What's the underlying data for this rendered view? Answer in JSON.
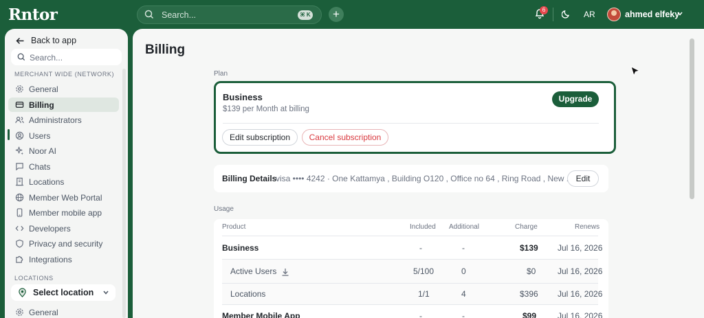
{
  "topbar": {
    "logo": "Rntor",
    "search_placeholder": "Search...",
    "search_shortcut": "⌘ K",
    "notification_count": "6",
    "language": "AR",
    "user_name": "ahmed elfeky"
  },
  "sidebar": {
    "back_label": "Back to app",
    "search_placeholder": "Search...",
    "section_network": "MERCHANT WIDE (NETWORK)",
    "items": [
      {
        "label": "General",
        "icon": "gear-icon"
      },
      {
        "label": "Billing",
        "icon": "card-icon",
        "active": true
      },
      {
        "label": "Administrators",
        "icon": "people-icon"
      },
      {
        "label": "Users",
        "icon": "user-circle-icon"
      },
      {
        "label": "Noor AI",
        "icon": "sparkle-icon"
      },
      {
        "label": "Chats",
        "icon": "chat-icon"
      },
      {
        "label": "Locations",
        "icon": "building-icon"
      },
      {
        "label": "Member Web Portal",
        "icon": "globe-icon"
      },
      {
        "label": "Member mobile app",
        "icon": "phone-icon"
      },
      {
        "label": "Developers",
        "icon": "code-icon"
      },
      {
        "label": "Privacy and security",
        "icon": "shield-icon"
      },
      {
        "label": "Integrations",
        "icon": "puzzle-icon"
      }
    ],
    "section_locations": "LOCATIONS",
    "location_select": "Select location",
    "location_items": [
      {
        "label": "General",
        "icon": "gear-icon"
      }
    ]
  },
  "main": {
    "title": "Billing",
    "plan_section_label": "Plan",
    "plan": {
      "name": "Business",
      "price_text": "$139 per Month at billing",
      "upgrade_label": "Upgrade",
      "edit_label": "Edit subscription",
      "cancel_label": "Cancel subscription"
    },
    "billing_details": {
      "title": "Billing Details",
      "info": "visa •••• 4242 · One Kattamya , Building O120 , Office no 64 , Ring Road , New ...",
      "edit_label": "Edit"
    },
    "usage_section_label": "Usage",
    "usage": {
      "columns": [
        "Product",
        "Included",
        "Additional",
        "Charge",
        "Renews"
      ],
      "rows": [
        {
          "product": "Business",
          "included": "-",
          "additional": "-",
          "charge": "$139",
          "renews": "Jul 16, 2026",
          "bold": true
        },
        {
          "product": "Active Users",
          "included": "5/100",
          "additional": "0",
          "charge": "$0",
          "renews": "Jul 16, 2026",
          "download": true
        },
        {
          "product": "Locations",
          "included": "1/1",
          "additional": "4",
          "charge": "$396",
          "renews": "Jul 16, 2026"
        },
        {
          "product": "Member Mobile App",
          "included": "-",
          "additional": "-",
          "charge": "$99",
          "renews": "Jul 16, 2026",
          "bold": true
        }
      ]
    }
  },
  "colors": {
    "brand": "#1b5e3a",
    "danger": "#d9383e",
    "badge": "#e5484d"
  }
}
